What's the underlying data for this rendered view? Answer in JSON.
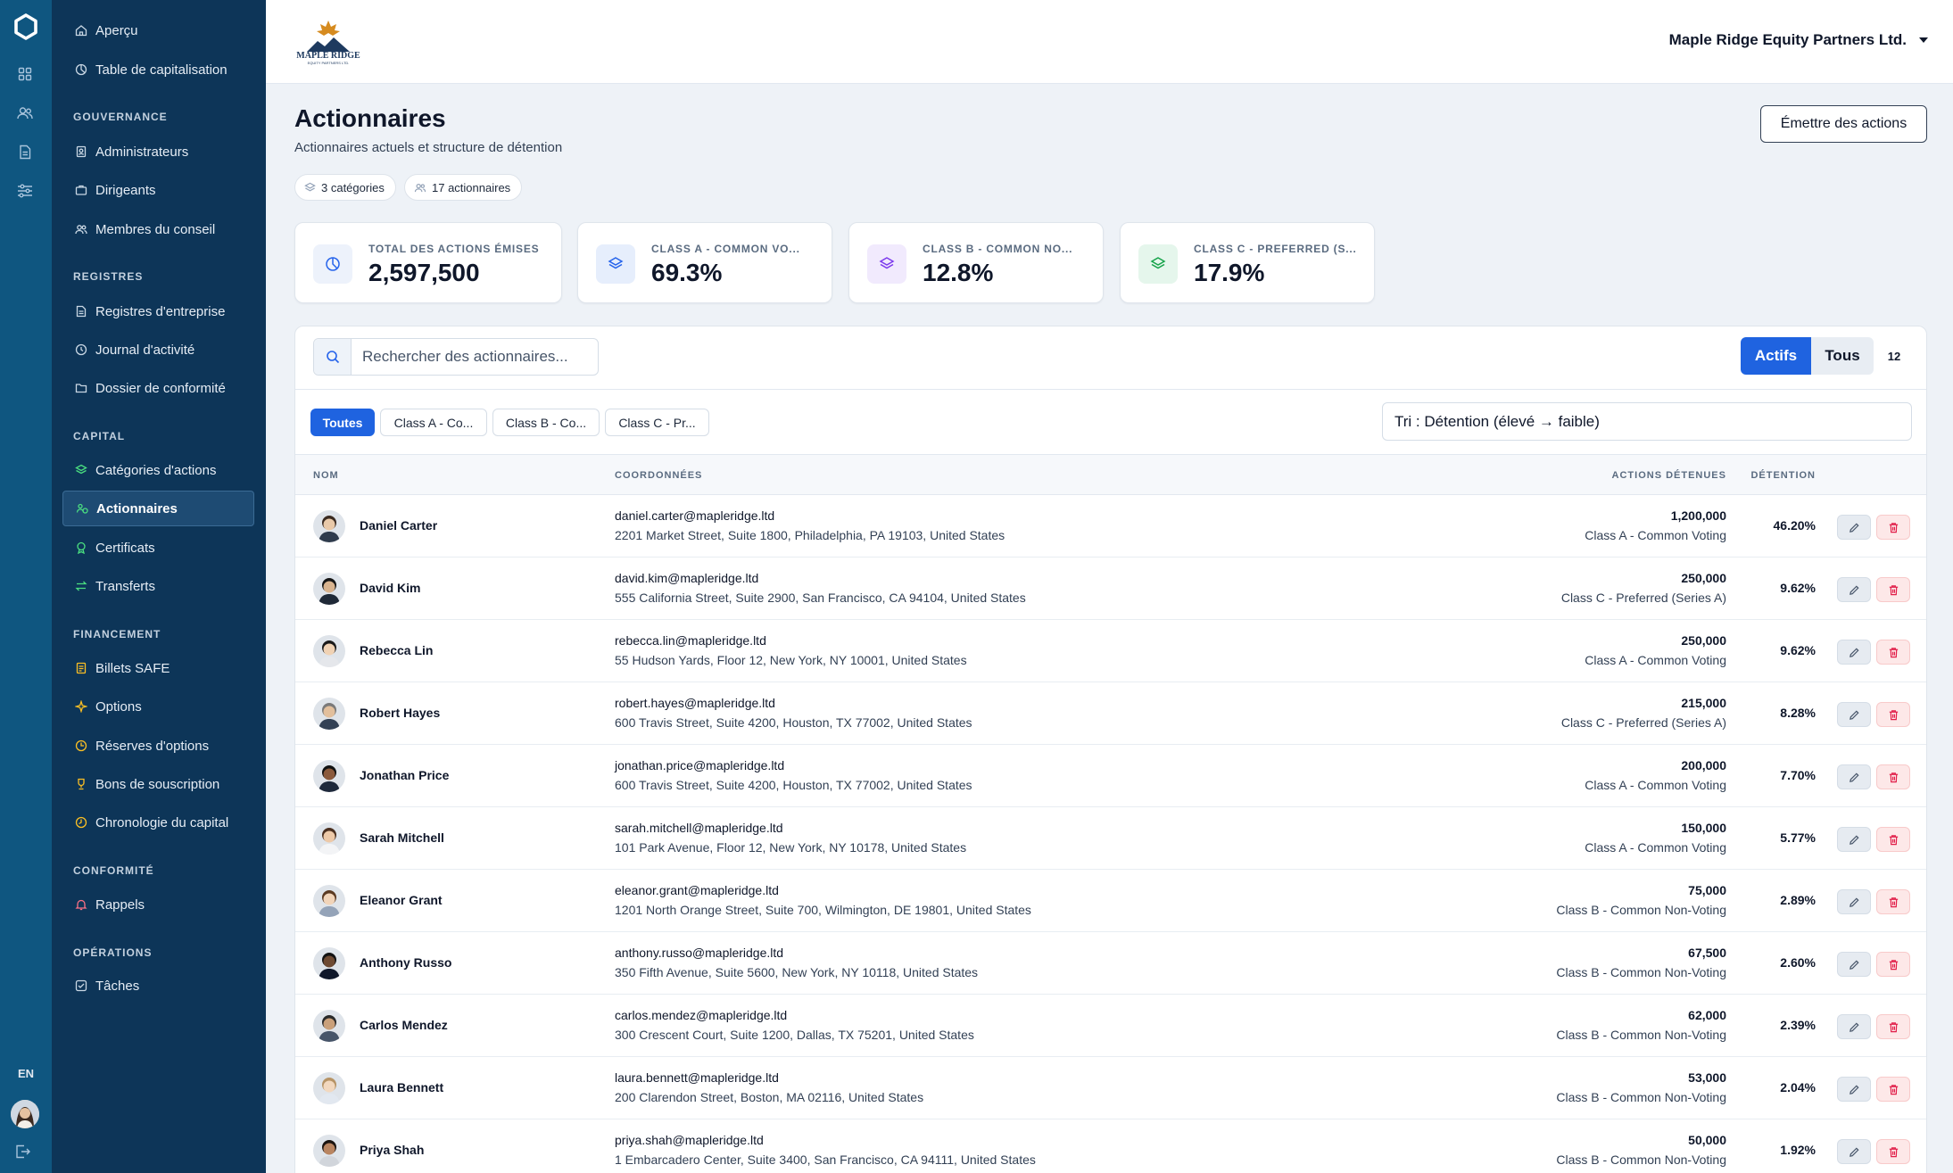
{
  "colors": {
    "rail": "#0f5680",
    "sidebar": "#0d3558",
    "accent": "#1f63e0",
    "class_a": "#2563eb",
    "class_b": "#7c3aed",
    "class_c": "#16a34a",
    "danger": "#e11d48"
  },
  "rail": {
    "lang": "EN"
  },
  "sidebar": {
    "top_items": [
      {
        "label": "Aperçu",
        "icon": "home-icon"
      },
      {
        "label": "Table de capitalisation",
        "icon": "pie-chart-icon"
      }
    ],
    "sections": [
      {
        "title": "GOUVERNANCE",
        "items": [
          {
            "label": "Administrateurs",
            "icon": "badge-icon"
          },
          {
            "label": "Dirigeants",
            "icon": "briefcase-icon"
          },
          {
            "label": "Membres du conseil",
            "icon": "users-icon"
          }
        ]
      },
      {
        "title": "REGISTRES",
        "items": [
          {
            "label": "Registres d'entreprise",
            "icon": "document-icon"
          },
          {
            "label": "Journal d'activité",
            "icon": "clock-icon"
          },
          {
            "label": "Dossier de conformité",
            "icon": "folder-icon"
          }
        ]
      },
      {
        "title": "CAPITAL",
        "items": [
          {
            "label": "Catégories d'actions",
            "icon": "layers-icon"
          },
          {
            "label": "Actionnaires",
            "icon": "shareholders-icon",
            "active": true
          },
          {
            "label": "Certificats",
            "icon": "certificate-icon"
          },
          {
            "label": "Transferts",
            "icon": "transfer-icon"
          }
        ]
      },
      {
        "title": "FINANCEMENT",
        "items": [
          {
            "label": "Billets SAFE",
            "icon": "note-icon"
          },
          {
            "label": "Options",
            "icon": "sparkle-icon"
          },
          {
            "label": "Réserves d'options",
            "icon": "pool-icon"
          },
          {
            "label": "Bons de souscription",
            "icon": "trophy-icon"
          },
          {
            "label": "Chronologie du capital",
            "icon": "timeline-icon"
          }
        ]
      },
      {
        "title": "CONFORMITÉ",
        "items": [
          {
            "label": "Rappels",
            "icon": "bell-icon"
          }
        ]
      },
      {
        "title": "OPÉRATIONS",
        "items": [
          {
            "label": "Tâches",
            "icon": "checkbox-icon"
          }
        ]
      }
    ]
  },
  "header": {
    "company": "Maple Ridge Equity Partners Ltd.",
    "logo_text": "MAPLE RIDGE",
    "logo_subtext": "EQUITY PARTNERS LTD."
  },
  "page": {
    "title": "Actionnaires",
    "subtitle": "Actionnaires actuels et structure de détention",
    "pill_categories": "3 catégories",
    "pill_holders": "17 actionnaires",
    "issue_button": "Émettre des actions"
  },
  "stats": [
    {
      "label": "TOTAL DES ACTIONS ÉMISES",
      "value": "2,597,500",
      "icon": "pie-chart-icon"
    },
    {
      "label": "CLASS A - COMMON VO...",
      "value": "69.3%",
      "icon": "layers-icon"
    },
    {
      "label": "CLASS B - COMMON NO...",
      "value": "12.8%",
      "icon": "layers-icon"
    },
    {
      "label": "CLASS C - PREFERRED (S...",
      "value": "17.9%",
      "icon": "layers-icon"
    }
  ],
  "toolbar": {
    "search_placeholder": "Rechercher des actionnaires...",
    "active_label": "Actifs",
    "all_label": "Tous",
    "count": "12",
    "filters": [
      "Toutes",
      "Class A - Co...",
      "Class B - Co...",
      "Class C - Pr..."
    ],
    "sort": "Tri : Détention (élevé → faible)"
  },
  "table": {
    "headers": {
      "name": "NOM",
      "contact": "COORDONNÉES",
      "shares": "ACTIONS DÉTENUES",
      "ownership": "DÉTENTION"
    },
    "rows": [
      {
        "name": "Daniel Carter",
        "email": "daniel.carter@mapleridge.ltd",
        "address": "2201 Market Street, Suite 1800, Philadelphia, PA 19103, United States",
        "shares": "1,200,000",
        "class": "Class A - Common Voting",
        "pct": "46.20%"
      },
      {
        "name": "David Kim",
        "email": "david.kim@mapleridge.ltd",
        "address": "555 California Street, Suite 2900, San Francisco, CA 94104, United States",
        "shares": "250,000",
        "class": "Class C - Preferred (Series A)",
        "pct": "9.62%"
      },
      {
        "name": "Rebecca Lin",
        "email": "rebecca.lin@mapleridge.ltd",
        "address": "55 Hudson Yards, Floor 12, New York, NY 10001, United States",
        "shares": "250,000",
        "class": "Class A - Common Voting",
        "pct": "9.62%"
      },
      {
        "name": "Robert Hayes",
        "email": "robert.hayes@mapleridge.ltd",
        "address": "600 Travis Street, Suite 4200, Houston, TX 77002, United States",
        "shares": "215,000",
        "class": "Class C - Preferred (Series A)",
        "pct": "8.28%"
      },
      {
        "name": "Jonathan Price",
        "email": "jonathan.price@mapleridge.ltd",
        "address": "600 Travis Street, Suite 4200, Houston, TX 77002, United States",
        "shares": "200,000",
        "class": "Class A - Common Voting",
        "pct": "7.70%"
      },
      {
        "name": "Sarah Mitchell",
        "email": "sarah.mitchell@mapleridge.ltd",
        "address": "101 Park Avenue, Floor 12, New York, NY 10178, United States",
        "shares": "150,000",
        "class": "Class A - Common Voting",
        "pct": "5.77%"
      },
      {
        "name": "Eleanor Grant",
        "email": "eleanor.grant@mapleridge.ltd",
        "address": "1201 North Orange Street, Suite 700, Wilmington, DE 19801, United States",
        "shares": "75,000",
        "class": "Class B - Common Non-Voting",
        "pct": "2.89%"
      },
      {
        "name": "Anthony Russo",
        "email": "anthony.russo@mapleridge.ltd",
        "address": "350 Fifth Avenue, Suite 5600, New York, NY 10118, United States",
        "shares": "67,500",
        "class": "Class B - Common Non-Voting",
        "pct": "2.60%"
      },
      {
        "name": "Carlos Mendez",
        "email": "carlos.mendez@mapleridge.ltd",
        "address": "300 Crescent Court, Suite 1200, Dallas, TX 75201, United States",
        "shares": "62,000",
        "class": "Class B - Common Non-Voting",
        "pct": "2.39%"
      },
      {
        "name": "Laura Bennett",
        "email": "laura.bennett@mapleridge.ltd",
        "address": "200 Clarendon Street, Boston, MA 02116, United States",
        "shares": "53,000",
        "class": "Class B - Common Non-Voting",
        "pct": "2.04%"
      },
      {
        "name": "Priya Shah",
        "email": "priya.shah@mapleridge.ltd",
        "address": "1 Embarcadero Center, Suite 3400, San Francisco, CA 94111, United States",
        "shares": "50,000",
        "class": "Class B - Common Non-Voting",
        "pct": "1.92%"
      }
    ]
  }
}
